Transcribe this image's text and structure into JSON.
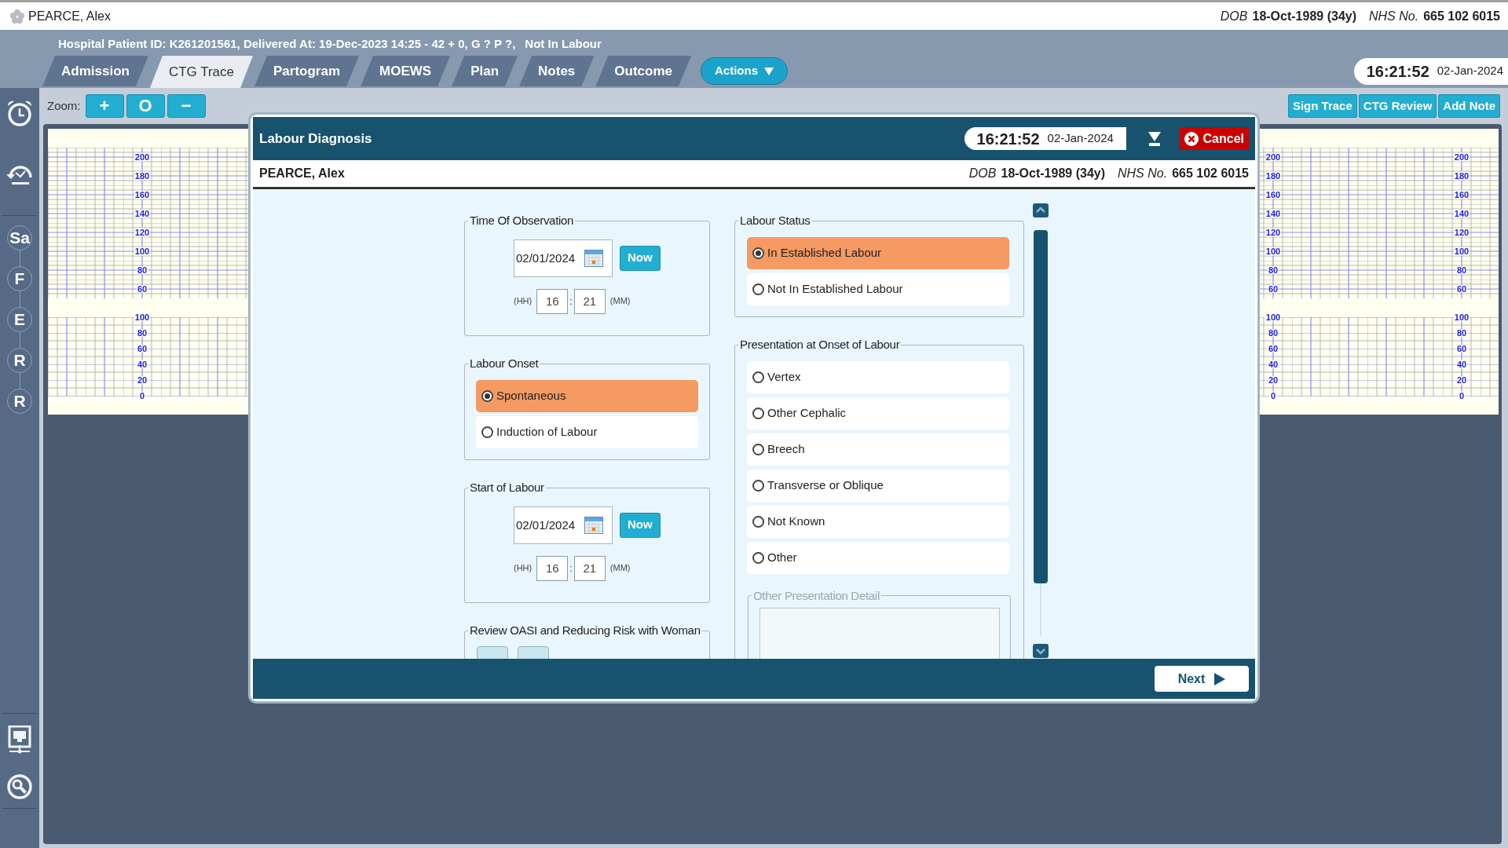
{
  "patient": {
    "name": "PEARCE, Alex",
    "dob_label": "DOB",
    "dob": "18-Oct-1989 (34y)",
    "nhs_label": "NHS No.",
    "nhs": "665 102 6015"
  },
  "info_line": "Hospital Patient ID: K261201561, Delivered At: 19-Dec-2023 14:25 - 42 + 0, G ? P ?,",
  "labour_state": "Not In Labour",
  "tabs": [
    {
      "label": "Admission",
      "selected": false
    },
    {
      "label": "CTG Trace",
      "selected": true
    },
    {
      "label": "Partogram",
      "selected": false
    },
    {
      "label": "MOEWS",
      "selected": false
    },
    {
      "label": "Plan",
      "selected": false
    },
    {
      "label": "Notes",
      "selected": false
    },
    {
      "label": "Outcome",
      "selected": false
    }
  ],
  "actions_button": "Actions",
  "clock": {
    "time": "16:21:52",
    "date": "02-Jan-2024"
  },
  "sidebar": {
    "badges": [
      {
        "label": "Sa"
      },
      {
        "label": "F"
      },
      {
        "label": "E"
      },
      {
        "label": "R"
      },
      {
        "label": "R"
      }
    ]
  },
  "zoom": {
    "label": "Zoom:",
    "buttons": [
      "+",
      "O",
      "−"
    ]
  },
  "trace_buttons": [
    "Sign Trace",
    "CTG Review",
    "Add Note"
  ],
  "ctg": {
    "scales": [
      {
        "fhr": [
          "200",
          "180",
          "160",
          "140",
          "120",
          "100",
          "80",
          "60"
        ],
        "toco": [
          "100",
          "80",
          "60",
          "40",
          "20",
          "0"
        ]
      },
      {
        "fhr": [
          "200",
          "180",
          "160",
          "140",
          "120",
          "100",
          "80",
          "60"
        ],
        "toco": [
          "100",
          "80",
          "60",
          "40",
          "20",
          "0"
        ]
      },
      {
        "fhr": [
          "200",
          "180",
          "160",
          "140",
          "120",
          "100",
          "80",
          "60"
        ],
        "toco": [
          "100",
          "80",
          "60",
          "40",
          "20",
          "0"
        ]
      }
    ]
  },
  "dialog": {
    "title": "Labour Diagnosis",
    "clock": {
      "time": "16:21:52",
      "date": "02-Jan-2024"
    },
    "cancel": "Cancel",
    "patient": {
      "name": "PEARCE, Alex",
      "dob_label": "DOB",
      "dob": "18-Oct-1989 (34y)",
      "nhs_label": "NHS No.",
      "nhs": "665 102 6015"
    },
    "left_groups": [
      {
        "kind": "datetime",
        "legend": "Time Of Observation",
        "date": "02/01/2024",
        "now": "Now",
        "hh_label": "(HH)",
        "hour": "16",
        "separator": ":",
        "minute": "21",
        "mm_label": "(MM)"
      },
      {
        "kind": "radio",
        "legend": "Labour Onset",
        "options": [
          {
            "label": "Spontaneous",
            "selected": true
          },
          {
            "label": "Induction of Labour",
            "selected": false
          }
        ]
      },
      {
        "kind": "datetime",
        "legend": "Start of Labour",
        "date": "02/01/2024",
        "now": "Now",
        "hh_label": "(HH)",
        "hour": "16",
        "separator": ":",
        "minute": "21",
        "mm_label": "(MM)"
      },
      {
        "kind": "yesno",
        "legend": "Review OASI and Reducing Risk with Woman"
      }
    ],
    "right_groups": [
      {
        "kind": "radio",
        "legend": "Labour Status",
        "options": [
          {
            "label": "In Established Labour",
            "selected": true
          },
          {
            "label": "Not In Established Labour",
            "selected": false
          }
        ]
      },
      {
        "kind": "radio",
        "legend": "Presentation at Onset of Labour",
        "options": [
          {
            "label": "Vertex",
            "selected": false
          },
          {
            "label": "Other Cephalic",
            "selected": false
          },
          {
            "label": "Breech",
            "selected": false
          },
          {
            "label": "Transverse or Oblique",
            "selected": false
          },
          {
            "label": "Not Known",
            "selected": false
          },
          {
            "label": "Other",
            "selected": false
          }
        ],
        "detail": {
          "legend": "Other Presentation Detail",
          "disabled": true
        }
      }
    ],
    "next": "Next"
  }
}
